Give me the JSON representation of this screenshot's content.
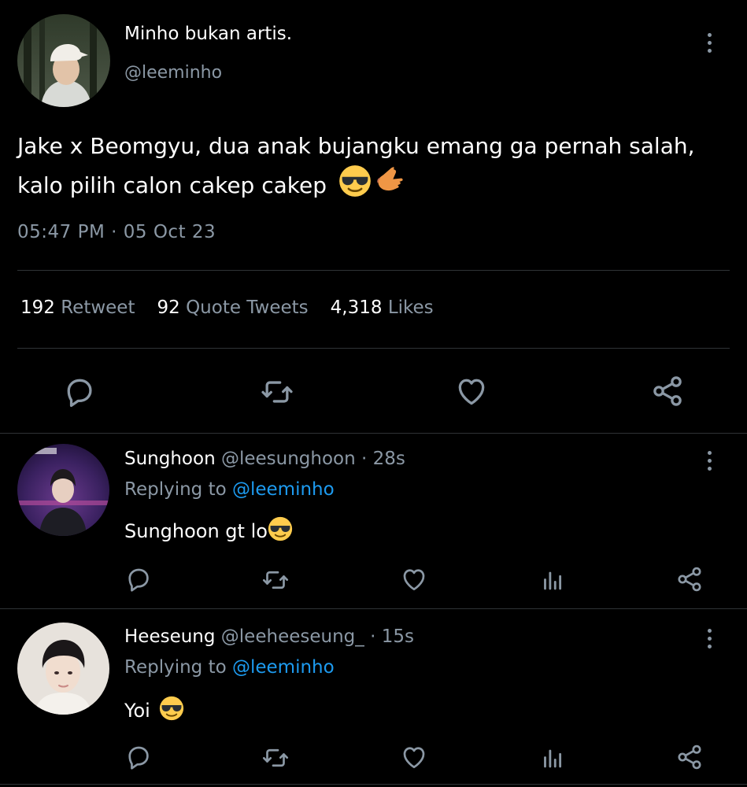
{
  "tweet": {
    "display_name": "Minho bukan artis.",
    "handle": "@leeminho",
    "text": "Jake x Beomgyu, dua anak bujangku emang ga pernah salah, kalo pilih calon cakep cakep",
    "emojis": [
      "sunglasses-emoji",
      "call-me-hand-emoji"
    ],
    "timestamp": "05:47 PM · 05 Oct 23",
    "stats": {
      "retweets_count": "192",
      "retweets_label": "Retweet",
      "quotes_count": "92",
      "quotes_label": "Quote Tweets",
      "likes_count": "4,318",
      "likes_label": "Likes"
    },
    "actions": [
      "reply-icon",
      "retweet-icon",
      "like-icon",
      "share-icon"
    ]
  },
  "replies": [
    {
      "display_name": "Sunghoon",
      "handle": "@leesunghoon",
      "time": "· 28s",
      "replying_label": "Replying to",
      "replying_to": "@leeminho",
      "text": "Sunghoon gt lo",
      "emoji": "sunglasses-emoji",
      "actions": [
        "reply-icon",
        "retweet-icon",
        "like-icon",
        "views-icon",
        "share-icon"
      ]
    },
    {
      "display_name": "Heeseung",
      "handle": "@leeheeseung_",
      "time": "· 15s",
      "replying_label": "Replying to",
      "replying_to": "@leeminho",
      "text": "Yoi",
      "emoji": "sunglasses-emoji",
      "actions": [
        "reply-icon",
        "retweet-icon",
        "like-icon",
        "views-icon",
        "share-icon"
      ]
    }
  ],
  "colors": {
    "background": "#000000",
    "primary_text": "#ffffff",
    "secondary_text": "#8b98a5",
    "link": "#1d9bf0",
    "divider": "#2f3336"
  }
}
